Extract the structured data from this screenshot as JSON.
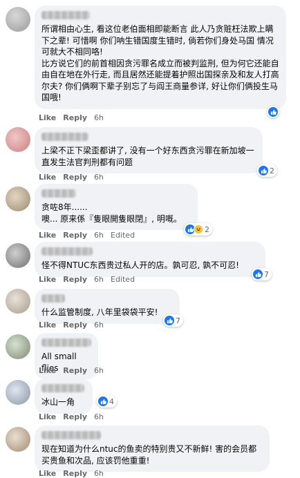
{
  "action_labels": {
    "like": "Like",
    "reply": "Reply"
  },
  "colors": {
    "bubble": "#f0f2f5",
    "like_blue": "#1877f2",
    "meta_gray": "#65676b",
    "haha_yellow": "#f7c13a"
  },
  "icons": {
    "like": "thumbs-up-icon",
    "haha": "laughing-face-icon"
  },
  "comments": [
    {
      "text": "所谓相由心生, 看这位老伯面相即能断言 此人乃贪赃枉法欺上瞒下之辈! 可惜啊 你们呐生错国度生错时, 倘若你们身处马国 情况可就大不相同咯!\n比方说它们的前首相因贪污罪名成立而被判监刑, 但为何它还能自由自在地在外行走, 而且居然还能提着护照出国探亲及和友人打高尔夫? 你们俩啊下辈子别忘了与阎王商量参详, 好让你们俩投生马国哦!",
      "time": "6h",
      "edited": "",
      "reactions": ""
    },
    {
      "text": "上梁不正下梁歪都讲了, 没有一个好东西贪污罪在新加坡一直发生法官判刑都有问题",
      "time": "6h",
      "edited": "",
      "reactions": "2"
    },
    {
      "text": "贪咗8年......\n噢... 原来係『隻眼開隻眼閉』, 明嘅。",
      "time": "6h",
      "edited": "Edited",
      "reactions": "2"
    },
    {
      "text": "怪不得NTUC东西贵过私人开的店。孰可忍, 孰不可忍!",
      "time": "6h",
      "edited": "Edited",
      "reactions": "7"
    },
    {
      "text": "什么监管制度, 八年里袋袋平安!",
      "time": "6h",
      "edited": "",
      "reactions": "7"
    },
    {
      "text": "All small flies",
      "time": "6h",
      "edited": "",
      "reactions": ""
    },
    {
      "text": "冰山一角",
      "time": "6h",
      "edited": "",
      "reactions": "4"
    },
    {
      "text": "现在知道为什么ntuc的鱼卖的特别贵又不新鲜! 害的会员都买贵鱼和次品, 应该罚他重重!",
      "time": "6h",
      "edited": "",
      "reactions": ""
    }
  ]
}
